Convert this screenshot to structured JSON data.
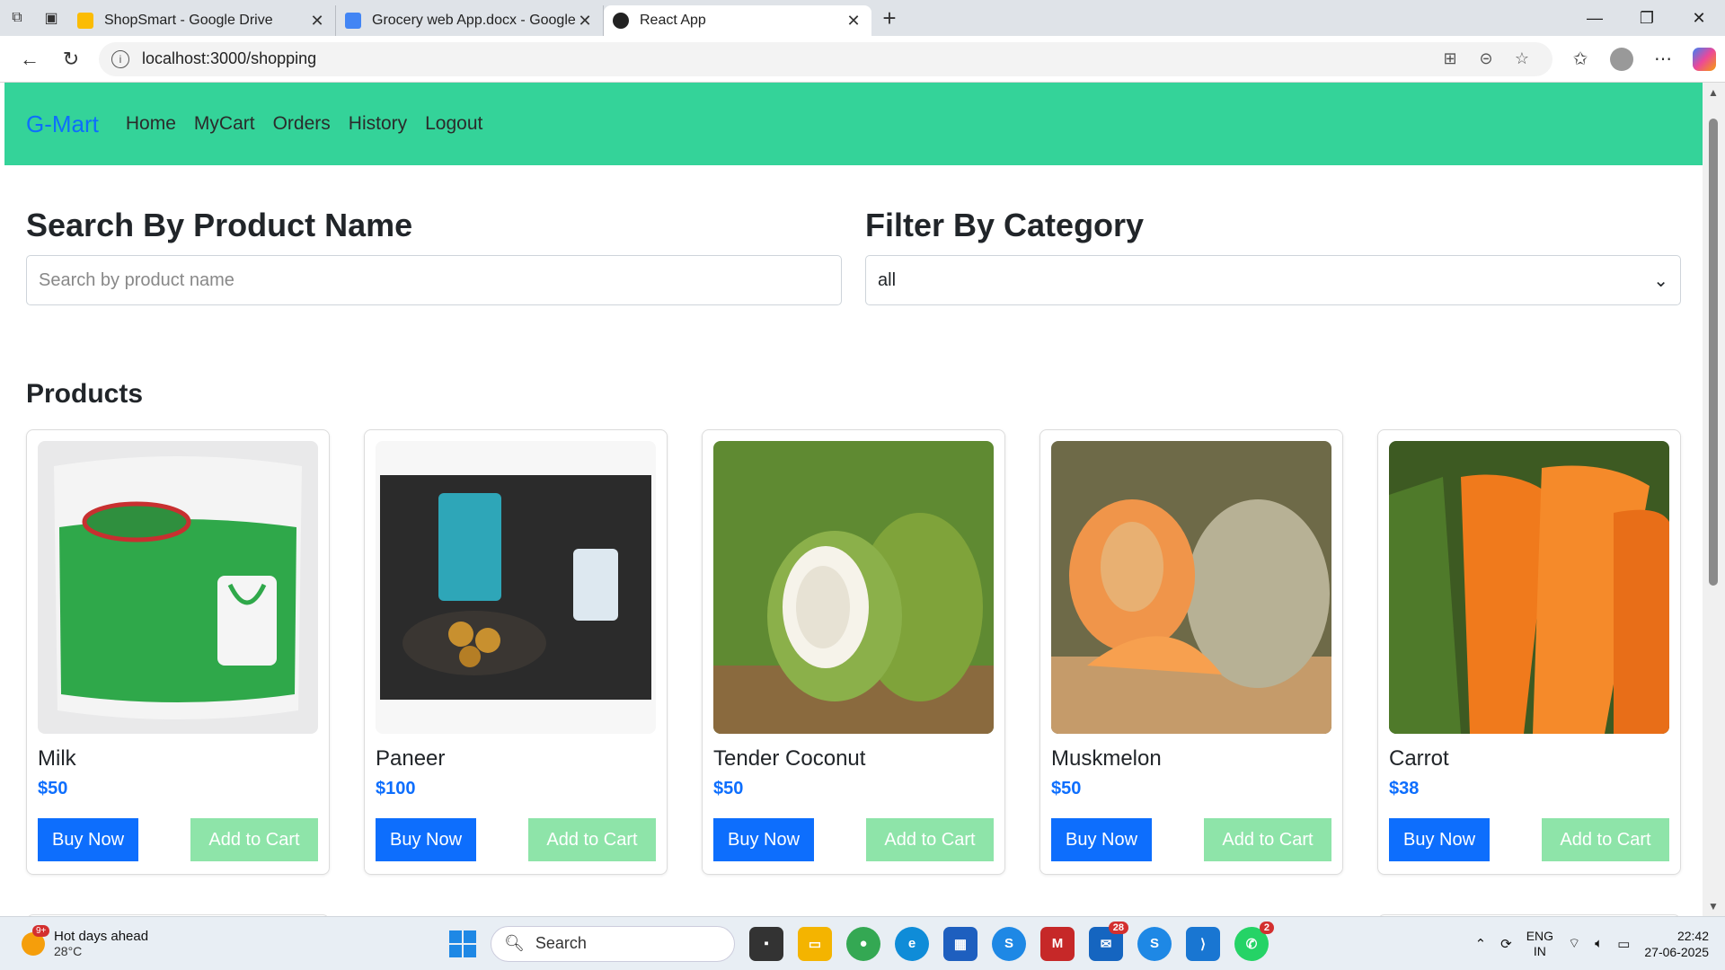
{
  "browser": {
    "tabs": [
      {
        "title": "ShopSmart - Google Drive",
        "favicon_color": "#fbbc04",
        "active": false
      },
      {
        "title": "Grocery web App.docx - Google Docs",
        "favicon_color": "#4285f4",
        "active": false
      },
      {
        "title": "React App",
        "favicon_color": "#222222",
        "active": true
      }
    ],
    "url": "localhost:3000/shopping"
  },
  "app": {
    "brand": "G-Mart",
    "nav": [
      "Home",
      "MyCart",
      "Orders",
      "History",
      "Logout"
    ],
    "search": {
      "heading": "Search By Product Name",
      "placeholder": "Search by product name"
    },
    "filter": {
      "heading": "Filter By Category",
      "selected": "all"
    },
    "products_heading": "Products",
    "buy_label": "Buy Now",
    "cart_label": "Add to Cart",
    "products": [
      {
        "name": "Milk",
        "price": "$50"
      },
      {
        "name": "Paneer",
        "price": "$100"
      },
      {
        "name": "Tender Coconut",
        "price": "$50"
      },
      {
        "name": "Muskmelon",
        "price": "$50"
      },
      {
        "name": "Carrot",
        "price": "$38"
      }
    ]
  },
  "taskbar": {
    "weather_title": "Hot days ahead",
    "weather_temp": "28°C",
    "weather_badge": "9+",
    "search_label": "Search",
    "badges": {
      "mail": "28",
      "whatsapp": "2"
    },
    "lang_1": "ENG",
    "lang_2": "IN",
    "time": "22:42",
    "date": "27-06-2025"
  },
  "colors": {
    "navbar": "#34d399",
    "brand": "#0d6efd",
    "buy": "#0d6efd",
    "cart": "#8ee4a9"
  }
}
